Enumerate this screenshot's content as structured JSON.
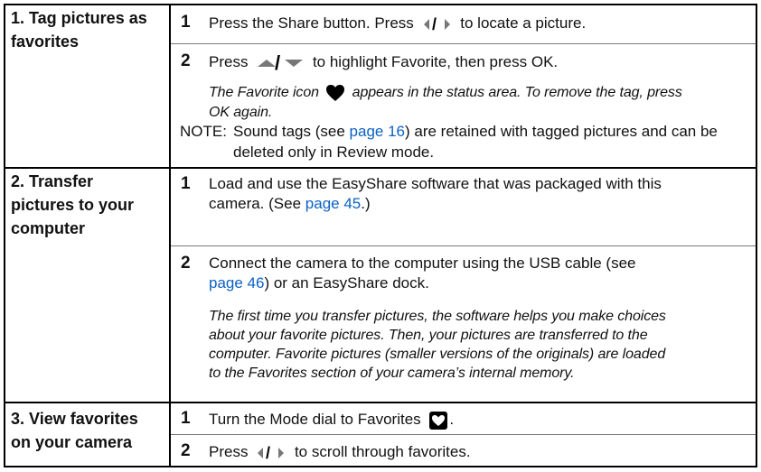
{
  "rows": [
    {
      "heading_l1": "1. Tag pictures as",
      "heading_l2": "favorites",
      "step1_a": "Press the Share button. Press",
      "step1_b": "to locate a picture.",
      "step2_a": "Press",
      "step2_b": "to highlight Favorite, then press OK.",
      "note_l1_a": "The Favorite icon",
      "note_l1_b": "appears in the status area. To remove the tag, press",
      "note_l2": "OK again.",
      "note_label": "NOTE:",
      "note_text_a": "Sound tags (see",
      "note_link": "page 16",
      "note_text_b": ") are retained with tagged pictures and can be",
      "note_text_c": "deleted only in Review mode."
    },
    {
      "heading_l1": "2. Transfer",
      "heading_l2": "pictures to your",
      "heading_l3": "computer",
      "step1_l1": "Load and use the EasyShare software that was packaged with this",
      "step1_l2_a": "camera. (See",
      "step1_l2_link": "page 45",
      "step1_l2_b": ".)",
      "step2_l1": "Connect the camera to the computer using the USB cable (see",
      "step2_l2_link": "page 46",
      "step2_l2_b": ") or an EasyShare dock.",
      "ital_l1": "The first time you transfer pictures, the software helps you make choices",
      "ital_l2": "about your favorite pictures. Then, your pictures are transferred to the",
      "ital_l3": "computer. Favorite pictures (smaller versions of the originals) are loaded",
      "ital_l4": "to the Favorites section of your camera’s internal memory."
    },
    {
      "heading_l1": "3. View favorites",
      "heading_l2": "on your camera",
      "step1": "Turn the Mode dial to Favorites",
      "step1_end": ".",
      "step2_a": "Press",
      "step2_b": "to scroll through favorites."
    }
  ],
  "step_numbers": [
    "1",
    "2"
  ],
  "icons": [
    "left-right-arrow-icon",
    "up-down-arrow-icon",
    "heart-icon",
    "favorites-mode-icon"
  ],
  "colors": {
    "link": "#0b62c4",
    "rule": "#000000"
  }
}
